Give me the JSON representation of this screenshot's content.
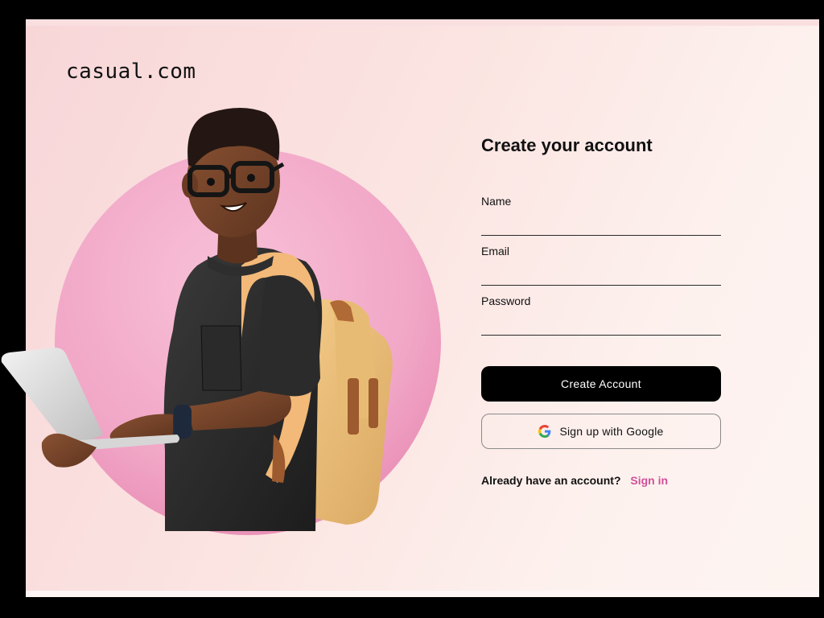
{
  "brand": {
    "logo_text": "casual.com"
  },
  "form": {
    "title": "Create your account",
    "fields": [
      {
        "label": "Name",
        "value": "",
        "placeholder": ""
      },
      {
        "label": "Email",
        "value": "",
        "placeholder": ""
      },
      {
        "label": "Password",
        "value": "",
        "placeholder": ""
      }
    ],
    "create_button_label": "Create Account",
    "google_button_label": "Sign up with Google",
    "signin_prompt": "Already have an account?",
    "signin_link": "Sign in"
  },
  "colors": {
    "accent_pink": "#d0519a",
    "circle_pink": "#f3a9c8",
    "primary_button": "#000000"
  },
  "icons": {
    "google": "google-g-icon"
  }
}
